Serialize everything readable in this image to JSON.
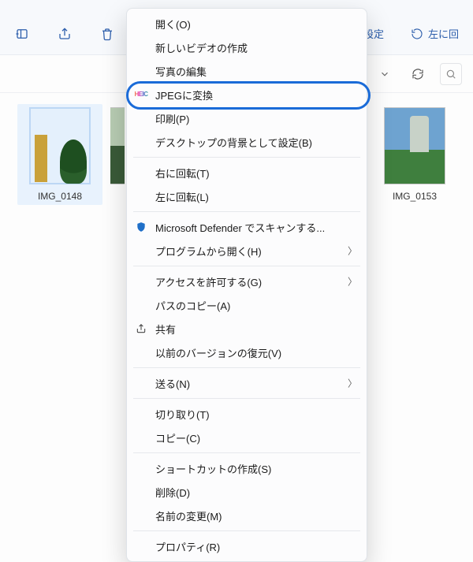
{
  "toolbar": {
    "settings_label": "設定",
    "rotate_left_label": "左に回"
  },
  "thumbs": {
    "img0": "IMG_0148",
    "img1": "IMG_0153"
  },
  "menu": {
    "open": "開く(O)",
    "new_video": "新しいビデオの作成",
    "edit_photo": "写真の編集",
    "to_jpeg": "JPEGに変換",
    "print": "印刷(P)",
    "set_wallpaper": "デスクトップの背景として設定(B)",
    "rotate_right": "右に回転(T)",
    "rotate_left": "左に回転(L)",
    "defender_scan": "Microsoft Defender でスキャンする...",
    "open_with": "プログラムから開く(H)",
    "give_access": "アクセスを許可する(G)",
    "copy_path": "パスのコピー(A)",
    "share": "共有",
    "restore_prev": "以前のバージョンの復元(V)",
    "send_to": "送る(N)",
    "cut": "切り取り(T)",
    "copy": "コピー(C)",
    "create_shortcut": "ショートカットの作成(S)",
    "delete": "削除(D)",
    "rename": "名前の変更(M)",
    "properties": "プロパティ(R)"
  }
}
